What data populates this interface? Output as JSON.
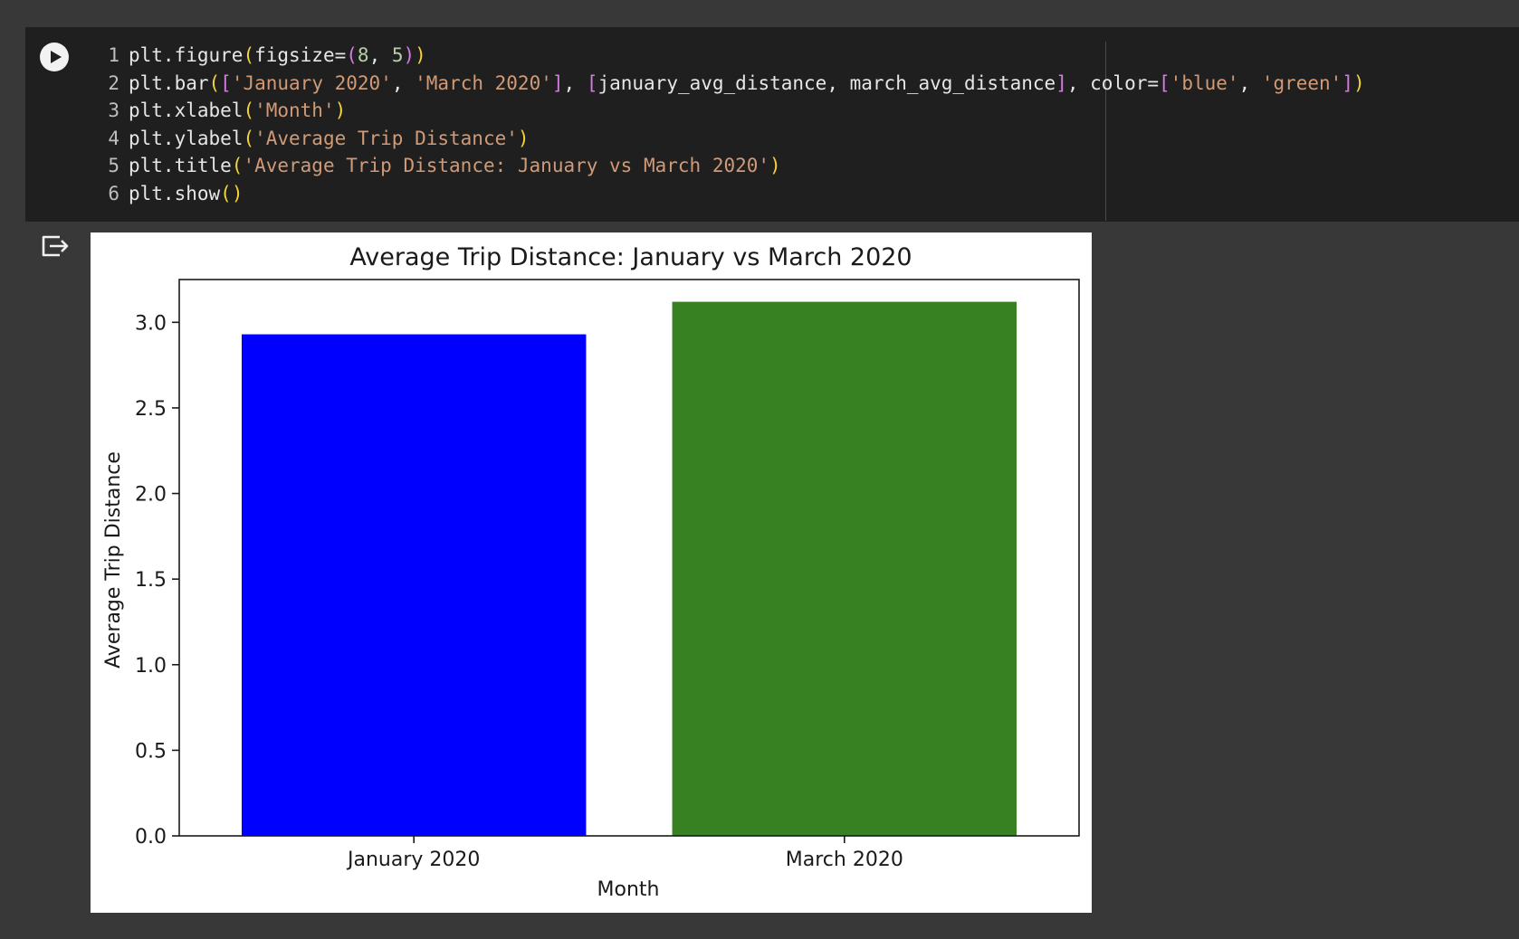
{
  "code": {
    "lines": [
      {
        "n": "1",
        "tokens": [
          [
            "plt.figure",
            ""
          ],
          [
            "(",
            "p1"
          ],
          [
            "figsize=",
            ""
          ],
          [
            "(",
            "p2"
          ],
          [
            "8",
            "n"
          ],
          [
            ", ",
            ""
          ],
          [
            "5",
            "n"
          ],
          [
            ")",
            "p2"
          ],
          [
            ")",
            "p1"
          ]
        ]
      },
      {
        "n": "2",
        "tokens": [
          [
            "plt.bar",
            ""
          ],
          [
            "(",
            "p1"
          ],
          [
            "[",
            "p2"
          ],
          [
            "'January 2020'",
            "s"
          ],
          [
            ", ",
            ""
          ],
          [
            "'March 2020'",
            "s"
          ],
          [
            "]",
            "p2"
          ],
          [
            ", ",
            ""
          ],
          [
            "[",
            "p2"
          ],
          [
            "january_avg_distance, march_avg_distance",
            ""
          ],
          [
            "]",
            "p2"
          ],
          [
            ", color=",
            ""
          ],
          [
            "[",
            "p2"
          ],
          [
            "'blue'",
            "s"
          ],
          [
            ", ",
            ""
          ],
          [
            "'green'",
            "s"
          ],
          [
            "]",
            "p2"
          ],
          [
            ")",
            "p1"
          ]
        ]
      },
      {
        "n": "3",
        "tokens": [
          [
            "plt.xlabel",
            ""
          ],
          [
            "(",
            "p1"
          ],
          [
            "'Month'",
            "s"
          ],
          [
            ")",
            "p1"
          ]
        ]
      },
      {
        "n": "4",
        "tokens": [
          [
            "plt.ylabel",
            ""
          ],
          [
            "(",
            "p1"
          ],
          [
            "'Average Trip Distance'",
            "s"
          ],
          [
            ")",
            "p1"
          ]
        ]
      },
      {
        "n": "5",
        "tokens": [
          [
            "plt.title",
            ""
          ],
          [
            "(",
            "p1"
          ],
          [
            "'Average Trip Distance: January vs March 2020'",
            "s"
          ],
          [
            ")",
            "p1"
          ]
        ]
      },
      {
        "n": "6",
        "tokens": [
          [
            "plt.show",
            ""
          ],
          [
            "(",
            "p1"
          ],
          [
            ")",
            "p1"
          ]
        ]
      }
    ]
  },
  "icons": {
    "run": "play-circle-icon",
    "output": "output-toggle-icon"
  },
  "chart_data": {
    "type": "bar",
    "title": "Average Trip Distance: January vs March 2020",
    "xlabel": "Month",
    "ylabel": "Average Trip Distance",
    "categories": [
      "January 2020",
      "March 2020"
    ],
    "values": [
      2.93,
      3.12
    ],
    "colors": [
      "#0000ff",
      "#388123"
    ],
    "ylim": [
      0,
      3.25
    ],
    "yticks": [
      "0.0",
      "0.5",
      "1.0",
      "1.5",
      "2.0",
      "2.5",
      "3.0"
    ],
    "grid": false
  }
}
